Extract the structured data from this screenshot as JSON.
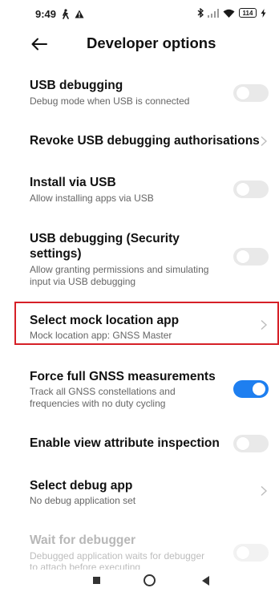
{
  "status_bar": {
    "time": "9:49",
    "battery": "114"
  },
  "header": {
    "title": "Developer options"
  },
  "settings": [
    {
      "title": "USB debugging",
      "subtitle": "Debug mode when USB is connected",
      "control": "toggle",
      "enabled": false
    },
    {
      "title": "Revoke USB debugging authorisations",
      "control": "chevron"
    },
    {
      "title": "Install via USB",
      "subtitle": "Allow installing apps via USB",
      "control": "toggle",
      "enabled": false
    },
    {
      "title_line1": "USB debugging (Security",
      "title_line2": "settings)",
      "subtitle_line1": "Allow granting permissions and simulating",
      "subtitle_line2": "input via USB debugging",
      "control": "toggle",
      "enabled": false
    },
    {
      "title": "Select mock location app",
      "subtitle": "Mock location app: GNSS Master",
      "control": "chevron",
      "highlighted": true
    },
    {
      "title": "Force full GNSS measurements",
      "subtitle_line1": "Track all GNSS constellations and",
      "subtitle_line2": "frequencies with no duty cycling",
      "control": "toggle",
      "enabled": true
    },
    {
      "title": "Enable view attribute inspection",
      "control": "toggle",
      "enabled": false
    },
    {
      "title": "Select debug app",
      "subtitle": "No debug application set",
      "control": "chevron"
    },
    {
      "title": "Wait for debugger",
      "subtitle_line1": "Debugged application waits for debugger",
      "subtitle_line2": "to attach before executing",
      "control": "toggle",
      "enabled": false,
      "disabled": true
    }
  ],
  "colors": {
    "toggle_on": "#1e7ff0",
    "toggle_off": "#e9e9e9",
    "highlight_border": "#d62027"
  }
}
